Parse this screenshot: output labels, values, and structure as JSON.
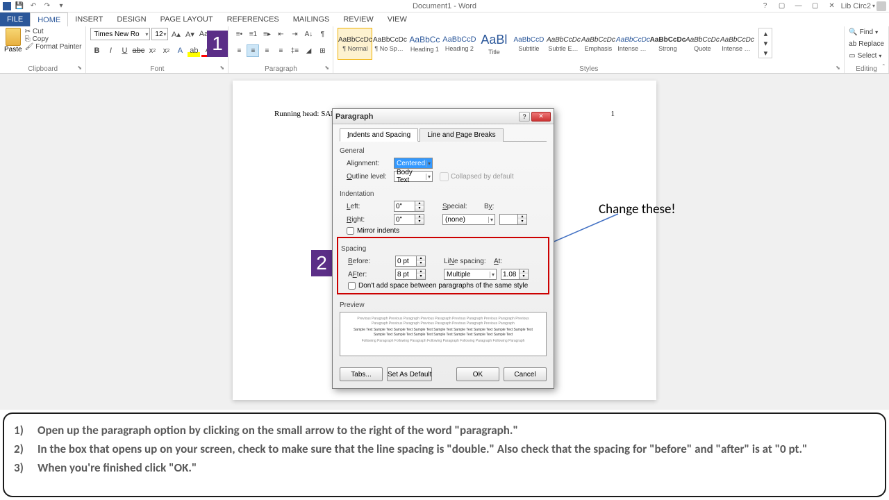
{
  "titlebar": {
    "doc_title": "Document1 - Word",
    "user": "Lib Circ2",
    "help": "?",
    "ribbon_opts": "▢",
    "minimize": "—",
    "restore": "▢",
    "close": "✕"
  },
  "tabs": {
    "file": "FILE",
    "home": "HOME",
    "insert": "INSERT",
    "design": "DESIGN",
    "page_layout": "PAGE LAYOUT",
    "references": "REFERENCES",
    "mailings": "MAILINGS",
    "review": "REVIEW",
    "view": "VIEW"
  },
  "clipboard": {
    "paste": "Paste",
    "cut": "Cut",
    "copy": "Copy",
    "format_painter": "Format Painter",
    "label": "Clipboard"
  },
  "font": {
    "name": "Times New Ro",
    "size": "12",
    "label": "Font"
  },
  "paragraph": {
    "label": "Paragraph"
  },
  "styles": {
    "label": "Styles",
    "items": [
      {
        "preview": "AaBbCcDc",
        "name": "¶ Normal"
      },
      {
        "preview": "AaBbCcDc",
        "name": "¶ No Spac..."
      },
      {
        "preview": "AaBbCc",
        "name": "Heading 1"
      },
      {
        "preview": "AaBbCcD",
        "name": "Heading 2"
      },
      {
        "preview": "AaBl",
        "name": "Title"
      },
      {
        "preview": "AaBbCcD",
        "name": "Subtitle"
      },
      {
        "preview": "AaBbCcDc",
        "name": "Subtle Em..."
      },
      {
        "preview": "AaBbCcDc",
        "name": "Emphasis"
      },
      {
        "preview": "AaBbCcDc",
        "name": "Intense E..."
      },
      {
        "preview": "AaBbCcDc",
        "name": "Strong"
      },
      {
        "preview": "AaBbCcDc",
        "name": "Quote"
      },
      {
        "preview": "AaBbCcDc",
        "name": "Intense Q..."
      }
    ]
  },
  "editing": {
    "find": "Find",
    "replace": "Replace",
    "select": "Select",
    "label": "Editing"
  },
  "document": {
    "running_head": "Running head: SAMPLE APA PAPER",
    "page_num": "1"
  },
  "badge1": "1",
  "badge2": "2",
  "annotation": "Change these!",
  "dialog": {
    "title": "Paragraph",
    "tab1": "Indents and Spacing",
    "tab2_pre": "Line and ",
    "tab2_u": "P",
    "tab2_post": "age Breaks",
    "general": "General",
    "alignment_u": "G",
    "alignment_label": "Alignment:",
    "alignment_value": "Centered",
    "outline_u": "O",
    "outline_label": "utline level:",
    "outline_value": "Body Text",
    "collapsed_u": "E",
    "collapsed_label": "Collapsed by default",
    "indentation": "Indentation",
    "left_u": "L",
    "left_label": "eft:",
    "left_value": "0\"",
    "right_u": "R",
    "right_label": "ight:",
    "right_value": "0\"",
    "special_u": "S",
    "special_label": "pecial:",
    "special_value": "(none)",
    "by_u": "y",
    "by_label": "B",
    "by_label2": ":",
    "mirror_u": "M",
    "mirror_label": "irror indents",
    "spacing": "Spacing",
    "before_u": "B",
    "before_label": "efore:",
    "before_value": "0 pt",
    "after_u": "F",
    "after_label_pre": "A",
    "after_label_post": "ter:",
    "after_value": "8 pt",
    "line_spacing_u": "N",
    "line_spacing_pre": "Li",
    "line_spacing_post": "e spacing:",
    "line_spacing_value": "Multiple",
    "at_u": "A",
    "at_label": "t:",
    "at_value": "1.08",
    "dont_add_u": "c",
    "dont_add_pre": "Don't add spa",
    "dont_add_post": "e between paragraphs of the same style",
    "preview": "Preview",
    "preview_grey": "Previous Paragraph Previous Paragraph Previous Paragraph Previous Paragraph Previous Paragraph Previous Paragraph Previous Paragraph Previous Paragraph Previous Paragraph Previous Paragraph",
    "preview_dark": "Sample Text Sample Text Sample Text Sample Text Sample Text Sample Text Sample Text Sample Text Sample Text Sample Text Sample Text Sample Text Sample Text Sample Text Sample Text Sample Text",
    "preview_grey2": "Following Paragraph Following Paragraph Following Paragraph Following Paragraph Following Paragraph",
    "tabs_btn_u": "T",
    "tabs_btn": "abs...",
    "default_btn_u": "D",
    "default_btn_pre": "Set As ",
    "default_btn_post": "efault",
    "ok": "OK",
    "cancel": "Cancel"
  },
  "instructions": {
    "i1": "Open up the paragraph option by clicking on the small arrow to the right of the word \"paragraph.\"",
    "i2": "In the box that opens up on your screen, check to make sure that the line spacing is \"double.\"  Also check that the spacing for \"before\" and \"after\" is at \"0 pt.\"",
    "i3": "When you're finished click \"OK.\""
  }
}
